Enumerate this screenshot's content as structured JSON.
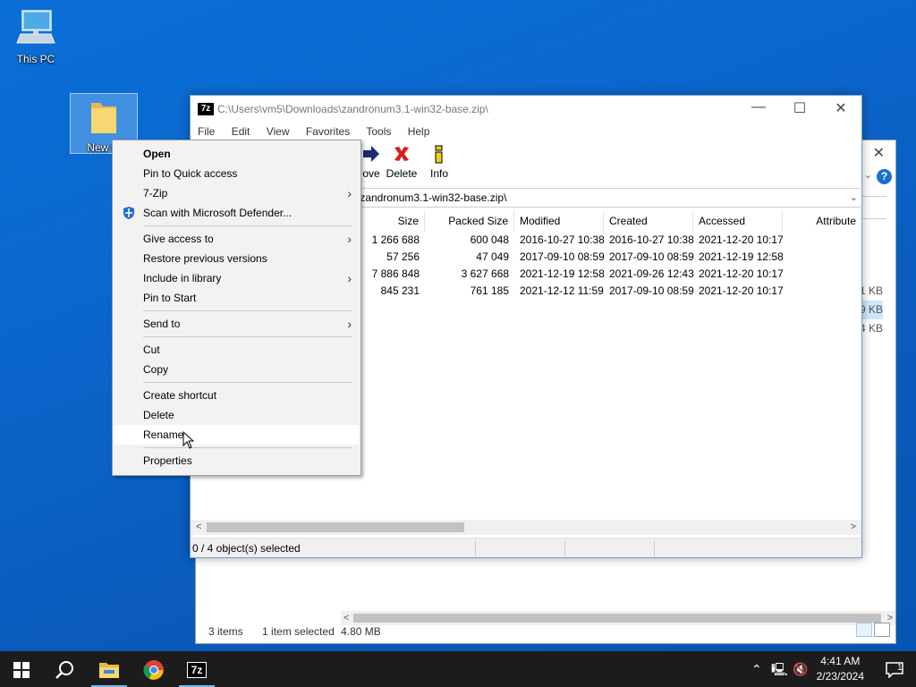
{
  "desktop": {
    "icons": [
      {
        "label": "This PC"
      },
      {
        "label": "New fo"
      }
    ]
  },
  "explorer_bg": {
    "side_sizes": [
      "1 KB",
      "9 KB",
      "4 KB"
    ],
    "status": {
      "items": "3 items",
      "selected": "1 item selected",
      "size": "4.80 MB"
    }
  },
  "sevenzip": {
    "app_icon_text": "7z",
    "title": "C:\\Users\\vm5\\Downloads\\zandronum3.1-win32-base.zip\\",
    "menu": [
      "File",
      "Edit",
      "View",
      "Favorites",
      "Tools",
      "Help"
    ],
    "toolbar": [
      {
        "label": "ove",
        "icon": "move-arrow-icon"
      },
      {
        "label": "Delete",
        "icon": "delete-x-icon"
      },
      {
        "label": "Info",
        "icon": "info-icon"
      }
    ],
    "address": "\\zandronum3.1-win32-base.zip\\",
    "columns": [
      "Size",
      "Packed Size",
      "Modified",
      "Created",
      "Accessed",
      "Attribute"
    ],
    "rows": [
      {
        "size": "1 266 688",
        "packed": "600 048",
        "modified": "2016-10-27 10:38",
        "created": "2016-10-27 10:38",
        "accessed": "2021-12-20 10:17"
      },
      {
        "size": "57 256",
        "packed": "47 049",
        "modified": "2017-09-10 08:59",
        "created": "2017-09-10 08:59",
        "accessed": "2021-12-19 12:58"
      },
      {
        "size": "7 886 848",
        "packed": "3 627 668",
        "modified": "2021-12-19 12:58",
        "created": "2021-09-26 12:43",
        "accessed": "2021-12-20 10:17"
      },
      {
        "size": "845 231",
        "packed": "761 185",
        "modified": "2021-12-12 11:59",
        "created": "2017-09-10 08:59",
        "accessed": "2021-12-20 10:17"
      }
    ],
    "status": "0 / 4 object(s) selected"
  },
  "context_menu": {
    "open": "Open",
    "pin_quick": "Pin to Quick access",
    "seven_zip": "7-Zip",
    "defender": "Scan with Microsoft Defender...",
    "give_access": "Give access to",
    "restore": "Restore previous versions",
    "include_library": "Include in library",
    "pin_start": "Pin to Start",
    "send_to": "Send to",
    "cut": "Cut",
    "copy": "Copy",
    "create_shortcut": "Create shortcut",
    "delete": "Delete",
    "rename": "Rename",
    "properties": "Properties"
  },
  "taskbar": {
    "time": "4:41 AM",
    "date": "2/23/2024",
    "seven_zip_label": "7z",
    "notification_count": "1"
  },
  "colors": {
    "desktop": "#0a6fd6",
    "taskbar": "#1c1c1c",
    "accent": "#76b9ed"
  }
}
